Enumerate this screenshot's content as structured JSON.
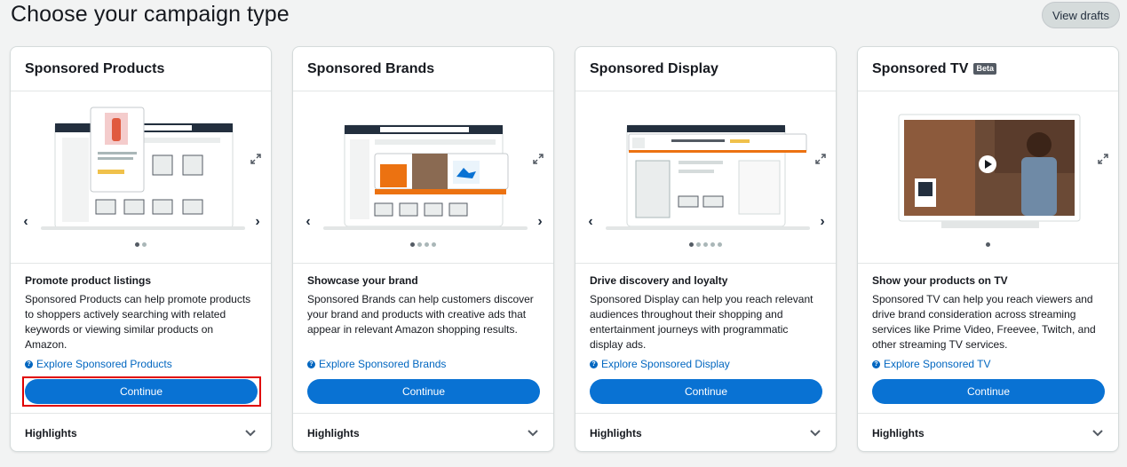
{
  "page": {
    "title": "Choose your campaign type",
    "view_drafts_label": "View drafts"
  },
  "cards": [
    {
      "title": "Sponsored Products",
      "heading": "Promote product listings",
      "description": "Sponsored Products can help promote products to shoppers actively searching with related keywords or viewing similar products on Amazon.",
      "link": "Explore Sponsored Products",
      "button": "Continue",
      "highlights": "Highlights",
      "dots": 2,
      "active_dot": 0
    },
    {
      "title": "Sponsored Brands",
      "heading": "Showcase your brand",
      "description": "Sponsored Brands can help customers discover your brand and products with creative ads that appear in relevant Amazon shopping results.",
      "link": "Explore Sponsored Brands",
      "button": "Continue",
      "highlights": "Highlights",
      "dots": 4,
      "active_dot": 0
    },
    {
      "title": "Sponsored Display",
      "heading": "Drive discovery and loyalty",
      "description": "Sponsored Display can help you reach relevant audiences throughout their shopping and entertainment journeys with programmatic display ads.",
      "link": "Explore Sponsored Display",
      "button": "Continue",
      "highlights": "Highlights",
      "dots": 5,
      "active_dot": 0
    },
    {
      "title": "Sponsored TV",
      "badge": "Beta",
      "heading": "Show your products on TV",
      "description": "Sponsored TV can help you reach viewers and drive brand consideration across streaming services like Prime Video, Freevee, Twitch, and other streaming TV services.",
      "link": "Explore Sponsored TV",
      "button": "Continue",
      "highlights": "Highlights",
      "dots": 1,
      "active_dot": 0
    }
  ],
  "colors": {
    "primary_button": "#0972d3",
    "link": "#0066c0",
    "highlight_box": "#e00000",
    "accent_orange": "#ec7211"
  },
  "icons": [
    "chevron-left-icon",
    "chevron-right-icon",
    "expand-icon",
    "help-icon",
    "chevron-down-icon",
    "play-icon"
  ]
}
